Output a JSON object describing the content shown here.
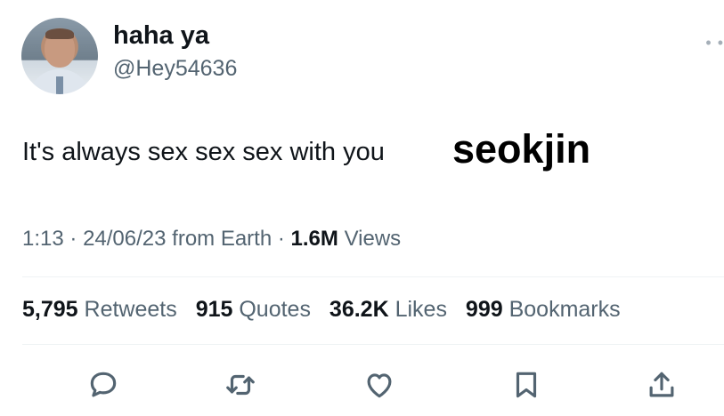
{
  "user": {
    "display_name": "haha ya",
    "handle": "@Hey54636"
  },
  "tweet": {
    "text": "It's always sex sex sex with you",
    "overlay_word": "seokjin"
  },
  "meta": {
    "time": "1:13",
    "sep1": "·",
    "date": "24/06/23",
    "source": "from Earth",
    "sep2": "·",
    "views_count": "1.6M",
    "views_label": "Views"
  },
  "stats": {
    "retweets_count": "5,795",
    "retweets_label": "Retweets",
    "quotes_count": "915",
    "quotes_label": "Quotes",
    "likes_count": "36.2K",
    "likes_label": "Likes",
    "bookmarks_count": "999",
    "bookmarks_label": "Bookmarks"
  },
  "icons": {
    "more": "more-horizontal-icon",
    "reply": "reply-bubble-icon",
    "retweet": "retweet-icon",
    "like": "heart-icon",
    "bookmark": "bookmark-icon",
    "share": "share-upload-icon"
  },
  "colors": {
    "text_primary": "#0f1419",
    "text_secondary": "#536471",
    "divider": "#eff3f4"
  }
}
